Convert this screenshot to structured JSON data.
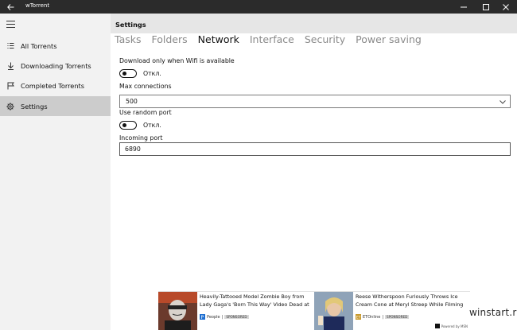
{
  "window": {
    "title": "wTorrent",
    "controls": [
      "minimize",
      "maximize",
      "close"
    ]
  },
  "sidebar": {
    "items": [
      {
        "label": "All Torrents",
        "icon": "list-icon"
      },
      {
        "label": "Downloading Torrents",
        "icon": "download-arrow-icon"
      },
      {
        "label": "Completed Torrents",
        "icon": "flag-icon"
      },
      {
        "label": "Settings",
        "icon": "gear-icon",
        "active": true
      }
    ]
  },
  "header": {
    "title": "Settings"
  },
  "tabs": [
    {
      "label": "Tasks"
    },
    {
      "label": "Folders"
    },
    {
      "label": "Network",
      "active": true
    },
    {
      "label": "Interface"
    },
    {
      "label": "Security"
    },
    {
      "label": "Power saving"
    }
  ],
  "settings": {
    "wifi_only": {
      "label": "Download only when Wifi is available",
      "state_text": "Откл.",
      "on": false
    },
    "max_connections": {
      "label": "Max connections",
      "value": "500"
    },
    "random_port": {
      "label": "Use random port",
      "state_text": "Откл.",
      "on": false
    },
    "incoming_port": {
      "label": "Incoming port",
      "value": "6890"
    }
  },
  "ad": {
    "items": [
      {
        "headline": "Heavily-Tattooed Model Zombie Boy from Lady Gaga's 'Born This Way' Video Dead at",
        "source": "People",
        "badge": "SPONSORED"
      },
      {
        "headline": "Reese Witherspoon Furiously Throws Ice Cream Cone at Meryl Streep While Filming",
        "source": "ETOnline",
        "badge": "SPONSORED"
      }
    ],
    "powered_by": "Powered by MSN"
  },
  "watermark": "winstart.ru",
  "colors": {
    "titlebar": "#2b2b2b",
    "sidebar": "#f2f2f2",
    "sidebar_active": "#cccccc",
    "header": "#e6e6e6"
  }
}
